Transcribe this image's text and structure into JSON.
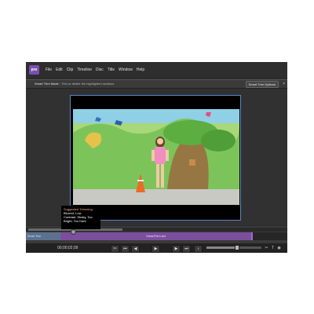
{
  "app": {
    "logo_text": "pre"
  },
  "menu": [
    "File",
    "Edit",
    "Clip",
    "Timeline",
    "Disc",
    "Title",
    "Window",
    "Help"
  ],
  "smart_trim": {
    "mode_label": "Smart Trim Mode",
    "hint": "Trim or delete the highlighted sections",
    "options_button": "Smart Trim Options",
    "close_glyph": "×"
  },
  "suggestion": {
    "title": "Suggested Trimming:",
    "lines": [
      "Blurred, Low",
      "Contrast, Shaky, Too",
      "Bright, Too Dark"
    ]
  },
  "timeline": {
    "clip_left_label": "Smart Trim",
    "clip_main_label": "SmartTrim.avi",
    "upper_segment_fraction": 0.36,
    "zoom_fraction": 0.55
  },
  "controls": {
    "timecode": "00;00;02;09",
    "buttons": [
      {
        "name": "split-clip-button",
        "glyph": "✂"
      },
      {
        "name": "goto-start-button",
        "glyph": "⏮"
      },
      {
        "name": "step-back-button",
        "glyph": "◀"
      },
      {
        "name": "play-button",
        "glyph": "▶"
      },
      {
        "name": "step-forward-button",
        "glyph": "▶"
      },
      {
        "name": "goto-end-button",
        "glyph": "⏭"
      },
      {
        "name": "volume-button",
        "glyph": "♪"
      }
    ],
    "tools": [
      {
        "name": "zoom-out-icon",
        "glyph": "−"
      },
      {
        "name": "zoom-in-icon",
        "glyph": "+"
      },
      {
        "name": "scissors-tool-icon",
        "glyph": "✂"
      },
      {
        "name": "text-tool-icon",
        "glyph": "T"
      },
      {
        "name": "disc-tool-icon",
        "glyph": "◉"
      }
    ]
  }
}
